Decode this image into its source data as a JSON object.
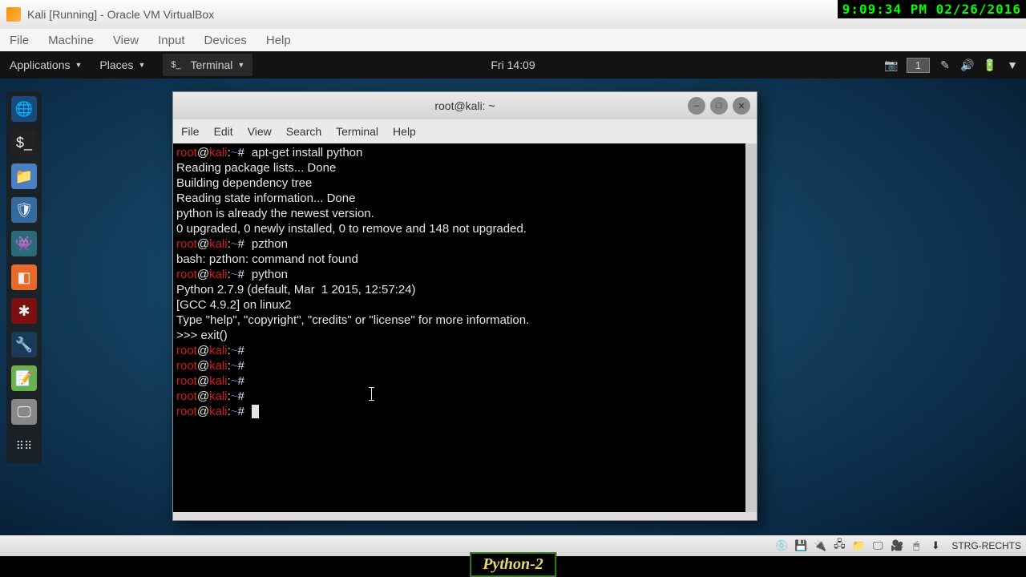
{
  "overlay": {
    "timestamp": "9:09:34 PM 02/26/2016"
  },
  "virtualbox": {
    "title": "Kali [Running] - Oracle VM VirtualBox",
    "menu": [
      "File",
      "Machine",
      "View",
      "Input",
      "Devices",
      "Help"
    ]
  },
  "gnome": {
    "topbar": {
      "applications": "Applications",
      "places": "Places",
      "active_app": "Terminal",
      "clock": "Fri 14:09",
      "workspace": "1"
    }
  },
  "terminal": {
    "title": "root@kali: ~",
    "menu": [
      "File",
      "Edit",
      "View",
      "Search",
      "Terminal",
      "Help"
    ],
    "prompt": {
      "user": "root",
      "host": "kali",
      "path": "~",
      "hash": "#"
    },
    "lines": {
      "cmd1": "apt-get install python",
      "out1": "Reading package lists... Done",
      "out2": "Building dependency tree",
      "out3": "Reading state information... Done",
      "out4": "python is already the newest version.",
      "out5": "0 upgraded, 0 newly installed, 0 to remove and 148 not upgraded.",
      "cmd2": "pzthon",
      "out6": "bash: pzthon: command not found",
      "cmd3": "python",
      "out7": "Python 2.7.9 (default, Mar  1 2015, 12:57:24)",
      "out8": "[GCC 4.9.2] on linux2",
      "out9": "Type \"help\", \"copyright\", \"credits\" or \"license\" for more information.",
      "out10": ">>> exit()"
    }
  },
  "host_statusbar": {
    "right_ctrl": "STRG-RECHTS"
  },
  "caption": "Python-2"
}
